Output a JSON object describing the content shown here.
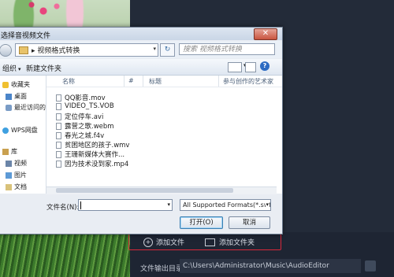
{
  "dialog": {
    "title": "选择音视频文件",
    "close_glyph": "✕",
    "address": {
      "path": "▸ 视频格式转换",
      "refresh_glyph": "↻"
    },
    "search": {
      "placeholder": "搜索 视频格式转换"
    },
    "toolbar": {
      "organize": "组织",
      "new_folder": "新建文件夹",
      "help": "?"
    },
    "nav": [
      {
        "label": "收藏夹",
        "icon": "star-icon"
      },
      {
        "label": "桌面",
        "icon": "desktop-icon"
      },
      {
        "label": "最近访问的位",
        "icon": "recent-places-icon"
      },
      {
        "label": "WPS网盘",
        "icon": "cloud-icon"
      },
      {
        "label": "库",
        "icon": "library-icon"
      },
      {
        "label": "视频",
        "icon": "video-icon"
      },
      {
        "label": "图片",
        "icon": "pictures-icon"
      },
      {
        "label": "文档",
        "icon": "documents-icon"
      }
    ],
    "columns": {
      "name": "名称",
      "number": "#",
      "title": "标题",
      "artists": "参与创作的艺术家"
    },
    "files": [
      "QQ影音.mov",
      "VIDEO_TS.VOB",
      "定位停车.avi",
      "露营之歌.webm",
      "春光之城.f4v",
      "贫困地区的孩子.wmv",
      "王珊新媒体大赛作...",
      "因为技术没到家.mp4"
    ],
    "filename_label": "文件名(N):",
    "filename_value": "",
    "filetype": "All Supported Formats(*.swf;",
    "open_button": "打开(O)",
    "cancel_button": "取消"
  },
  "app": {
    "add_file": "添加文件",
    "add_folder": "添加文件夹",
    "output_label": "文件输出目录：",
    "output_path": "C:\\Users\\Administrator\\Music\\AudioEditor"
  },
  "colors": {
    "highlight": "#d8283a",
    "panel": "#1e2533"
  }
}
